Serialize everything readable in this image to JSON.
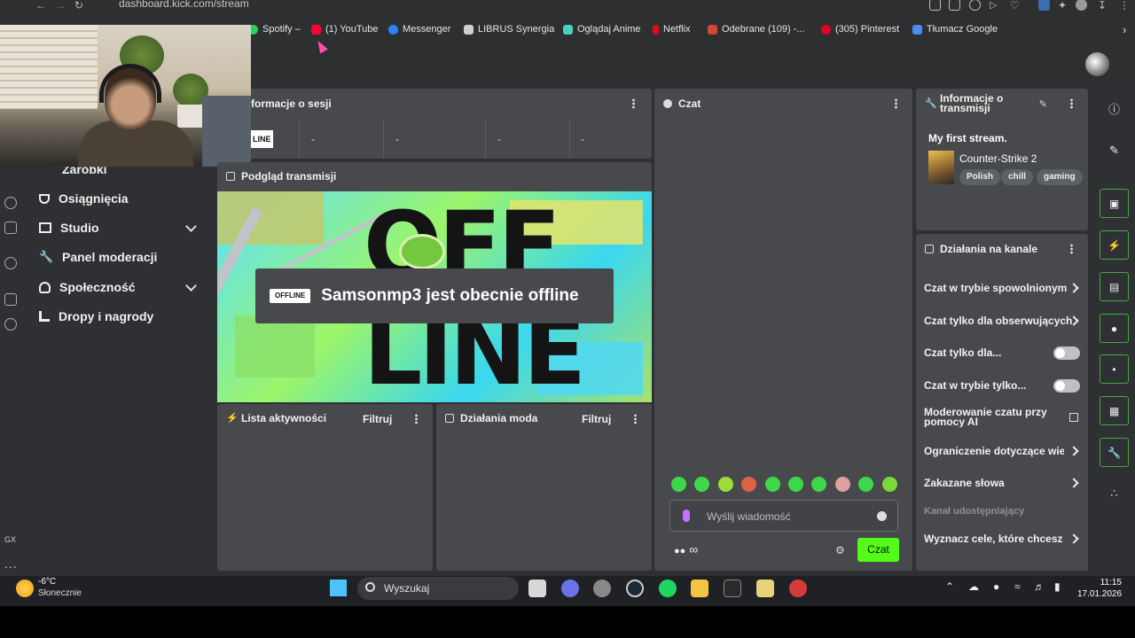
{
  "browser": {
    "url": "dashboard.kick.com/stream",
    "bookmarks": [
      {
        "label": "Spotify –",
        "color": "#1ed760"
      },
      {
        "label": "(1) YouTube",
        "color": "#ff0033"
      },
      {
        "label": "Messenger",
        "color": "#2a84ff"
      },
      {
        "label": "LIBRUS Synergia",
        "color": "#d0d0d0"
      },
      {
        "label": "Oglądaj Anime",
        "color": "#4ad0c0"
      },
      {
        "label": "Netflix",
        "color": "#e50914"
      },
      {
        "label": "Odebrane (109) -...",
        "color": "#d44638"
      },
      {
        "label": "(305) Pinterest",
        "color": "#e60023"
      },
      {
        "label": "Tłumacz Google",
        "color": "#4a8cf0"
      }
    ]
  },
  "sidebar": {
    "items": [
      {
        "label": "Zarobki",
        "icon": "dollar-icon"
      },
      {
        "label": "Osiągnięcia",
        "icon": "trophy-icon"
      },
      {
        "label": "Studio",
        "icon": "studio-icon"
      },
      {
        "label": "Panel moderacji",
        "icon": "wrench-icon"
      },
      {
        "label": "Społeczność",
        "icon": "community-icon"
      },
      {
        "label": "Dropy i nagrody",
        "icon": "drops-icon"
      }
    ],
    "gx_label": "GX",
    "more": "..."
  },
  "session": {
    "title": "Informacje o sesji",
    "title_visible": "formacje o sesji",
    "status_visible": "LINE",
    "stats": [
      "-",
      "-",
      "-",
      "-"
    ]
  },
  "preview": {
    "title": "Podgląd transmisji",
    "big_top": "OFF",
    "big_bottom": "LINE",
    "badge": "OFFLINE",
    "message": "Samsonmp3 jest obecnie offline"
  },
  "activity": {
    "title": "Lista aktywności",
    "filter": "Filtruj"
  },
  "mod_actions": {
    "title": "Działania moda",
    "filter": "Filtruj"
  },
  "chat": {
    "title": "Czat",
    "placeholder": "Wyślij wiadomość",
    "infinity": "∞",
    "send_label": "Czat",
    "emote_colors": [
      "#3dd84a",
      "#3dd84a",
      "#9ddc3a",
      "#e06048",
      "#3dd84a",
      "#3dd84a",
      "#3dd84a",
      "#e0a0a0",
      "#3dd84a",
      "#7ad83a"
    ]
  },
  "stream_info": {
    "title": "Informacje o transmisji",
    "stream_title": "My first stream.",
    "game": "Counter-Strike 2",
    "tags": [
      "Polish",
      "chill",
      "gaming"
    ]
  },
  "channel_actions": {
    "title": "Działania na kanale",
    "items": [
      {
        "label": "Czat w trybie spowolnionym",
        "control": "chevron"
      },
      {
        "label": "Czat tylko dla obserwujących",
        "control": "chevron"
      },
      {
        "label": "Czat tylko dla...",
        "control": "toggle"
      },
      {
        "label": "Czat w trybie tylko...",
        "control": "toggle"
      },
      {
        "label": "Moderowanie czatu przy pomocy AI",
        "control": "external"
      },
      {
        "label": "Ograniczenie dotyczące wieku",
        "control": "chevron"
      },
      {
        "label": "Zakazane słowa",
        "control": "chevron"
      },
      {
        "label": "Kanał udostępniający",
        "control": "none"
      },
      {
        "label": "Wyznacz cele, które chcesz osiągnąć",
        "control": "chevron"
      }
    ]
  },
  "taskbar": {
    "temperature": "-6°C",
    "weather": "Słonecznie",
    "search_label": "Wyszukaj",
    "time": "11:15",
    "date": "17.01.2026"
  },
  "colors": {
    "accent": "#53fc18",
    "panel": "#47494c",
    "background": "#2f3033"
  }
}
